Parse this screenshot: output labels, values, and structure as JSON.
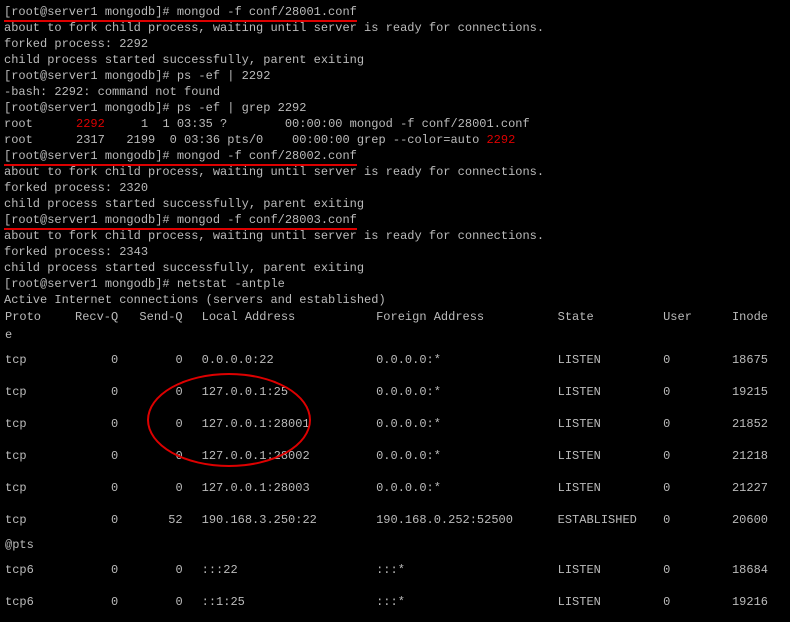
{
  "lines": {
    "prompt1": "[root@server1 mongodb]# ",
    "cmd1": "mongod -f conf/28001.conf",
    "fork_msg": "about to fork child process, waiting until server is ready for connections.",
    "forked1": "forked process: 2292",
    "success": "child process started successfully, parent exiting",
    "cmd2": "ps -ef | 2292",
    "bash_err": "-bash: 2292: command not found",
    "cmd3": "ps -ef | grep 2292",
    "ps1_pre": "root      ",
    "ps1_pid": "2292",
    "ps1_rest": "     1  1 03:35 ?        00:00:00 mongod -f conf/28001.conf",
    "ps2_pre": "root      2317   2199  0 03:36 pts/0    00:00:00 grep --color=auto ",
    "ps2_pid": "2292",
    "cmd4": "mongod -f conf/28002.conf",
    "forked2": "forked process: 2320",
    "cmd5": "mongod -f conf/28003.conf",
    "forked3": "forked process: 2343",
    "cmd6": "netstat -antple",
    "active": "Active Internet connections (servers and established)"
  },
  "table": {
    "headers": [
      "Proto",
      "Recv-Q",
      "Send-Q",
      "Local Address",
      "Foreign Address",
      "State",
      "User",
      "Inode"
    ],
    "rows": [
      {
        "proto": "tcp",
        "recvq": "0",
        "sendq": "0",
        "local": "0.0.0.0:22",
        "foreign": "0.0.0.0:*",
        "state": "LISTEN",
        "user": "0",
        "inode": "18675"
      },
      {
        "proto": "tcp",
        "recvq": "0",
        "sendq": "0",
        "local": "127.0.0.1:25",
        "foreign": "0.0.0.0:*",
        "state": "LISTEN",
        "user": "0",
        "inode": "19215"
      },
      {
        "proto": "tcp",
        "recvq": "0",
        "sendq": "0",
        "local": "127.0.0.1:28001",
        "foreign": "0.0.0.0:*",
        "state": "LISTEN",
        "user": "0",
        "inode": "21852"
      },
      {
        "proto": "tcp",
        "recvq": "0",
        "sendq": "0",
        "local": "127.0.0.1:28002",
        "foreign": "0.0.0.0:*",
        "state": "LISTEN",
        "user": "0",
        "inode": "21218"
      },
      {
        "proto": "tcp",
        "recvq": "0",
        "sendq": "0",
        "local": "127.0.0.1:28003",
        "foreign": "0.0.0.0:*",
        "state": "LISTEN",
        "user": "0",
        "inode": "21227"
      },
      {
        "proto": "tcp",
        "recvq": "0",
        "sendq": "52",
        "local": "190.168.3.250:22",
        "foreign": "190.168.0.252:52500",
        "state": "ESTABLISHED",
        "user": "0",
        "inode": "20600",
        "suffix": "@pts"
      },
      {
        "proto": "tcp6",
        "recvq": "0",
        "sendq": "0",
        "local": ":::22",
        "foreign": ":::*",
        "state": "LISTEN",
        "user": "0",
        "inode": "18684"
      },
      {
        "proto": "tcp6",
        "recvq": "0",
        "sendq": "0",
        "local": "::1:25",
        "foreign": ":::*",
        "state": "LISTEN",
        "user": "0",
        "inode": "19216"
      }
    ]
  },
  "extra": {
    "e": "e"
  }
}
